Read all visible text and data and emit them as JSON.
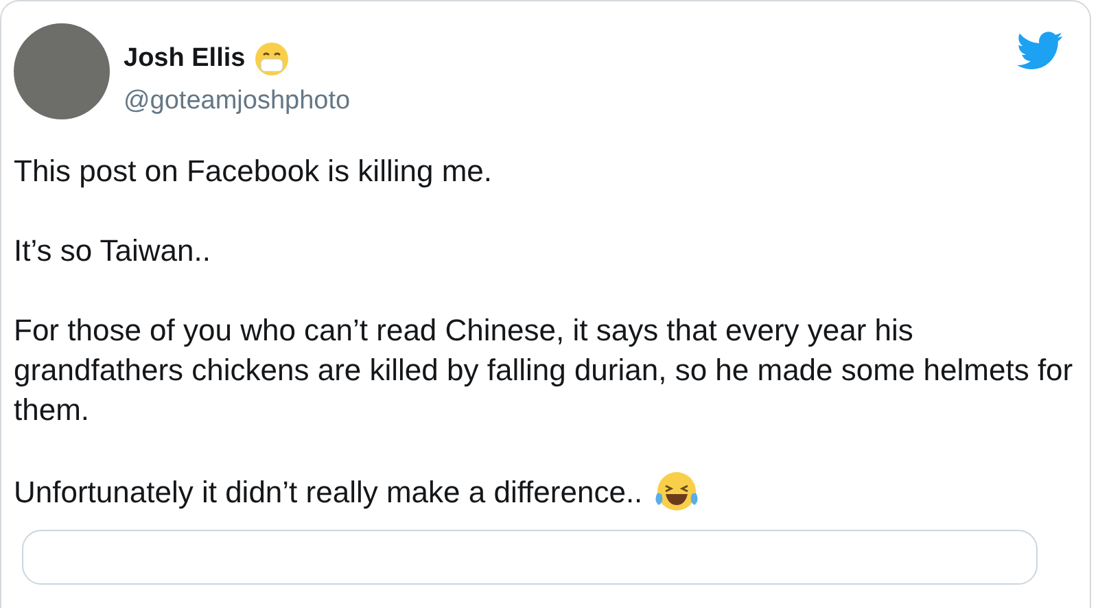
{
  "author": {
    "name": "Josh Ellis",
    "handle": "@goteamjoshphoto"
  },
  "paragraphs": [
    "This post on Facebook is killing me.",
    "It’s so Taiwan..",
    "For those of you who can’t read Chinese, it says that every year his grandfathers chickens are killed by falling durian, so he made some helmets for them.",
    "Unfortunately it didn’t really make a difference.."
  ]
}
